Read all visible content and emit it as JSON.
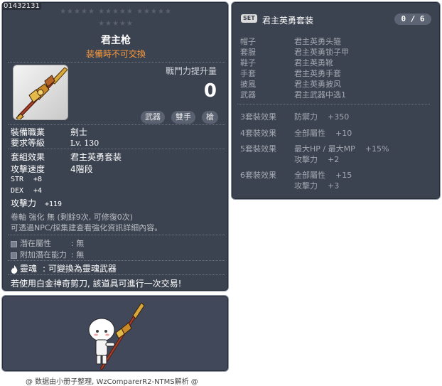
{
  "item": {
    "code": "01432131",
    "star_rows": [
      "★★★★★   ★★★★★   ★★★★★",
      "★★★★★"
    ],
    "name": "君主枪",
    "note": "装備時不可交換",
    "damage_label": "戰鬥力提升量",
    "damage_value": "0",
    "tags": [
      "武器",
      "雙手",
      "槍"
    ],
    "job_label": "裝備職業",
    "job_value": "劍士",
    "level_label": "要求等級",
    "level_value": "Lv. 130",
    "set_label": "套組效果",
    "set_value": "君主英勇套装",
    "speed_label": "攻擊速度",
    "speed_value": "4階段",
    "stats": [
      {
        "label": "STR",
        "value": "+8"
      },
      {
        "label": "DEX",
        "value": "+4"
      }
    ],
    "attack_label": "攻擊力",
    "attack_value": "+119",
    "upgrade_line": "卷軸 強化 無 (剩餘9次, 可修復0次)",
    "npc_line": "可透過NPC/採集建查看強化資訊詳細內容。",
    "potential_label": "潛在屬性",
    "potential_value": ": 無",
    "bonus_potential_label": "附加潛在能力",
    "bonus_potential_value": ": 無",
    "soul_label": "靈魂",
    "soul_value": ": 可變換為靈魂武器",
    "trade_line": "若使用白金神奇剪刀, 該道具可進行一次交易!"
  },
  "footer": "@ 数据由小册子整理, WzComparerR2-NTMS解析 @",
  "set": {
    "badge": "SET",
    "name": "君主英勇套装",
    "count": "0 / 6",
    "parts": [
      {
        "slot": "帽子",
        "item": "君主英勇头箍"
      },
      {
        "slot": "套服",
        "item": "君主英勇锁子甲"
      },
      {
        "slot": "鞋子",
        "item": "君主英勇靴"
      },
      {
        "slot": "手套",
        "item": "君主英勇手套"
      },
      {
        "slot": "披風",
        "item": "君主英勇披风"
      },
      {
        "slot": "武器",
        "item": "君主武器中选1"
      }
    ],
    "effects": [
      {
        "label": "3套裝效果",
        "lines": [
          {
            "stat": "防禦力",
            "value": "+350"
          }
        ]
      },
      {
        "label": "4套裝效果",
        "lines": [
          {
            "stat": "全部屬性",
            "value": "+10"
          }
        ]
      },
      {
        "label": "5套裝效果",
        "lines": [
          {
            "stat": "最大HP / 最大MP",
            "value": "+15%"
          },
          {
            "stat": "攻擊力",
            "value": "+2"
          }
        ]
      },
      {
        "label": "6套裝效果",
        "lines": [
          {
            "stat": "全部屬性",
            "value": "+15"
          },
          {
            "stat": "攻擊力",
            "value": "+3"
          }
        ]
      }
    ]
  },
  "colors": {
    "panel_bg": "#3c4350",
    "panel_border": "#8a93a3",
    "note_orange": "#ff9b3b",
    "set_text": "#a3a8b1"
  },
  "icons": [
    "spear-icon",
    "potential-icon",
    "soul-flame-icon",
    "character-sprite"
  ]
}
